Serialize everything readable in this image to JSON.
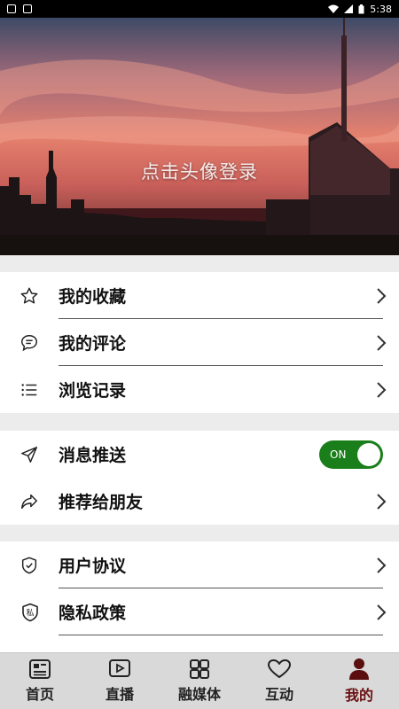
{
  "status_bar": {
    "time": "5:38"
  },
  "hero": {
    "login_text": "点击头像登录"
  },
  "section1": {
    "items": [
      {
        "label": "我的收藏",
        "icon": "star-icon"
      },
      {
        "label": "我的评论",
        "icon": "comment-icon"
      },
      {
        "label": "浏览记录",
        "icon": "list-icon"
      }
    ]
  },
  "section2": {
    "push": {
      "label": "消息推送",
      "icon": "send-icon",
      "toggle": "ON"
    },
    "recommend": {
      "label": "推荐给朋友",
      "icon": "share-icon"
    }
  },
  "section3": {
    "items": [
      {
        "label": "用户协议",
        "icon": "shield-check-icon"
      },
      {
        "label": "隐私政策",
        "icon": "shield-private-icon",
        "badge": "私"
      }
    ]
  },
  "bottom_nav": {
    "items": [
      {
        "label": "首页",
        "icon": "news-icon"
      },
      {
        "label": "直播",
        "icon": "video-icon"
      },
      {
        "label": "融媒体",
        "icon": "grid-icon"
      },
      {
        "label": "互动",
        "icon": "heart-icon"
      },
      {
        "label": "我的",
        "icon": "person-icon",
        "active": true
      }
    ]
  },
  "colors": {
    "accent": "#6b1010",
    "toggle_on": "#1a7e1a",
    "background": "#ececec"
  }
}
